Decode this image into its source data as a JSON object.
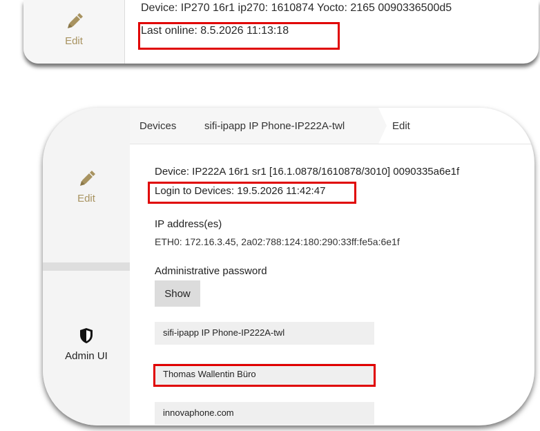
{
  "top_card": {
    "edit_label": "Edit",
    "device_line": "Device: IP270 16r1 ip270: 1610874 Yocto: 2165 0090336500d5",
    "last_online": "Last online: 8.5.2026 11:13:18"
  },
  "main_card": {
    "breadcrumb": {
      "devices": "Devices",
      "device_name": "sifi-ipapp IP Phone-IP222A-twl",
      "current": "Edit"
    },
    "sidebar": {
      "edit_label": "Edit",
      "admin_label": "Admin UI"
    },
    "device_line": "Device: IP222A 16r1 sr1 [16.1.0878/1610878/3010] 0090335a6e1f",
    "login_line": "Login to Devices: 19.5.2026 11:42:47",
    "ip_heading": "IP address(es)",
    "ip_value": "ETH0: 172.16.3.45, 2a02:788:124:180:290:33ff:fe5a:6e1f",
    "password_heading": "Administrative password",
    "show_label": "Show",
    "fields": {
      "name": "sifi-ipapp IP Phone-IP222A-twl",
      "display_name": "Thomas Wallentin Büro",
      "domain": "innovaphone.com"
    }
  },
  "colors": {
    "highlight": "#e00000",
    "edit_accent": "#a89360"
  },
  "icons": {
    "edit": "pencil-icon",
    "admin": "shield-icon"
  }
}
